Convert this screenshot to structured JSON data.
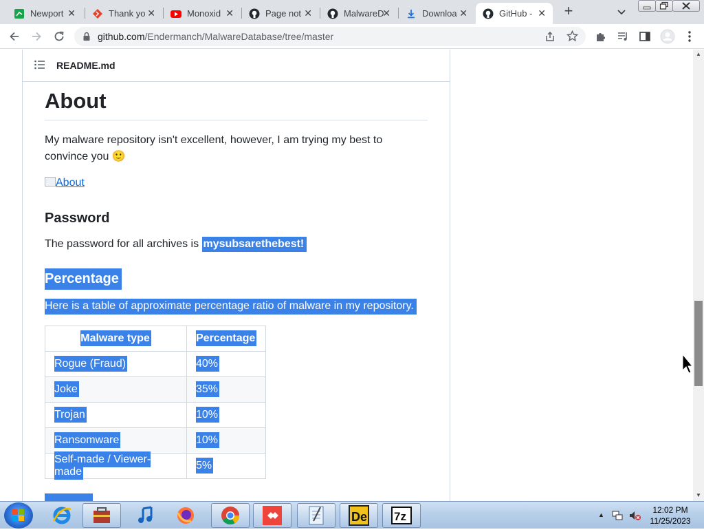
{
  "browser": {
    "tabs": [
      {
        "label": "Newport",
        "icon": "green-square-icon",
        "active": false
      },
      {
        "label": "Thank yo",
        "icon": "red-diamond-icon",
        "active": false
      },
      {
        "label": "Monoxid",
        "icon": "youtube-icon",
        "active": false
      },
      {
        "label": "Page not",
        "icon": "github-icon",
        "active": false
      },
      {
        "label": "MalwareD",
        "icon": "github-icon",
        "active": false
      },
      {
        "label": "Downloa",
        "icon": "download-icon",
        "active": false
      },
      {
        "label": "GitHub -",
        "icon": "github-icon",
        "active": true
      }
    ],
    "tab_close_glyph": "✕",
    "new_tab_glyph": "+",
    "address": {
      "host": "github.com",
      "path": "/Endermanch/MalwareDatabase/tree/master"
    }
  },
  "readme": {
    "filename": "README.md",
    "about_heading": "About",
    "about_text": "My malware repository isn't excellent, however, I am trying my best to convince you 🙂",
    "about_image_alt": "About",
    "password_heading": "Password",
    "password_text": "The password for all archives is ",
    "password_value": "mysubsarethebest!",
    "percentage_heading": "Percentage",
    "percentage_text": "Here is a table of approximate percentage ratio of malware in my repository.",
    "table": {
      "headers": [
        "Malware type",
        "Percentage"
      ],
      "rows": [
        [
          "Rogue (Fraud)",
          "40%"
        ],
        [
          "Joke",
          "35%"
        ],
        [
          "Trojan",
          "10%"
        ],
        [
          "Ransomware",
          "10%"
        ],
        [
          "Self-made / Viewer-made",
          "5%"
        ]
      ]
    },
    "selection_color": "#3b82e8"
  },
  "taskbar": {
    "apps": [
      {
        "name": "internet-explorer-icon",
        "pinned": false
      },
      {
        "name": "toolbox-icon",
        "pinned": true
      },
      {
        "name": "itunes-icon",
        "pinned": false
      },
      {
        "name": "firefox-icon",
        "pinned": false
      },
      {
        "name": "chrome-icon",
        "pinned": true
      },
      {
        "name": "anydesk-icon",
        "pinned": true
      },
      {
        "name": "notepad-icon",
        "pinned": true
      },
      {
        "name": "de-app-icon",
        "pinned": true
      },
      {
        "name": "7zip-icon",
        "pinned": true
      }
    ],
    "time": "12:02 PM",
    "date": "11/25/2023"
  }
}
